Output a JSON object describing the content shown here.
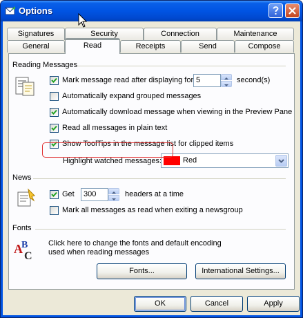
{
  "window": {
    "title": "Options"
  },
  "tabs_row_back": [
    {
      "label": "Signatures"
    },
    {
      "label": "Security"
    },
    {
      "label": "Connection"
    },
    {
      "label": "Maintenance"
    }
  ],
  "tabs_row_front": [
    {
      "label": "General"
    },
    {
      "label": "Read",
      "selected": true
    },
    {
      "label": "Receipts"
    },
    {
      "label": "Send"
    },
    {
      "label": "Compose"
    }
  ],
  "reading": {
    "heading": "Reading Messages",
    "mark_read": {
      "checked": true,
      "label_before": "Mark message read after displaying for",
      "value": "5",
      "label_after": "second(s)"
    },
    "expand_grouped": {
      "checked": false,
      "label": "Automatically expand grouped messages"
    },
    "auto_download": {
      "checked": true,
      "label": "Automatically download message when viewing in the Preview Pane"
    },
    "plain_text": {
      "checked": true,
      "label": "Read all messages in plain text"
    },
    "tooltips": {
      "checked": true,
      "label": "Show ToolTips in the message list for clipped items"
    },
    "highlight_watched": {
      "label": "Highlight watched messages:",
      "value": "Red",
      "color": "#ff0000"
    }
  },
  "news": {
    "heading": "News",
    "get": {
      "checked": true,
      "label": "Get",
      "value": "300",
      "label_after": "headers at a time"
    },
    "mark_all": {
      "checked": false,
      "label": "Mark all messages as read when exiting a newsgroup"
    }
  },
  "fonts": {
    "heading": "Fonts",
    "description_line1": "Click here to change the fonts and default encoding",
    "description_line2": "used when reading messages",
    "fonts_button": "Fonts...",
    "international_button": "International Settings..."
  },
  "footer": {
    "ok": "OK",
    "cancel": "Cancel",
    "apply": "Apply"
  },
  "colors": {
    "titlebar": "#0054e3",
    "highlight_ring": "#e03030",
    "tab_accent": "#ffc83c"
  }
}
